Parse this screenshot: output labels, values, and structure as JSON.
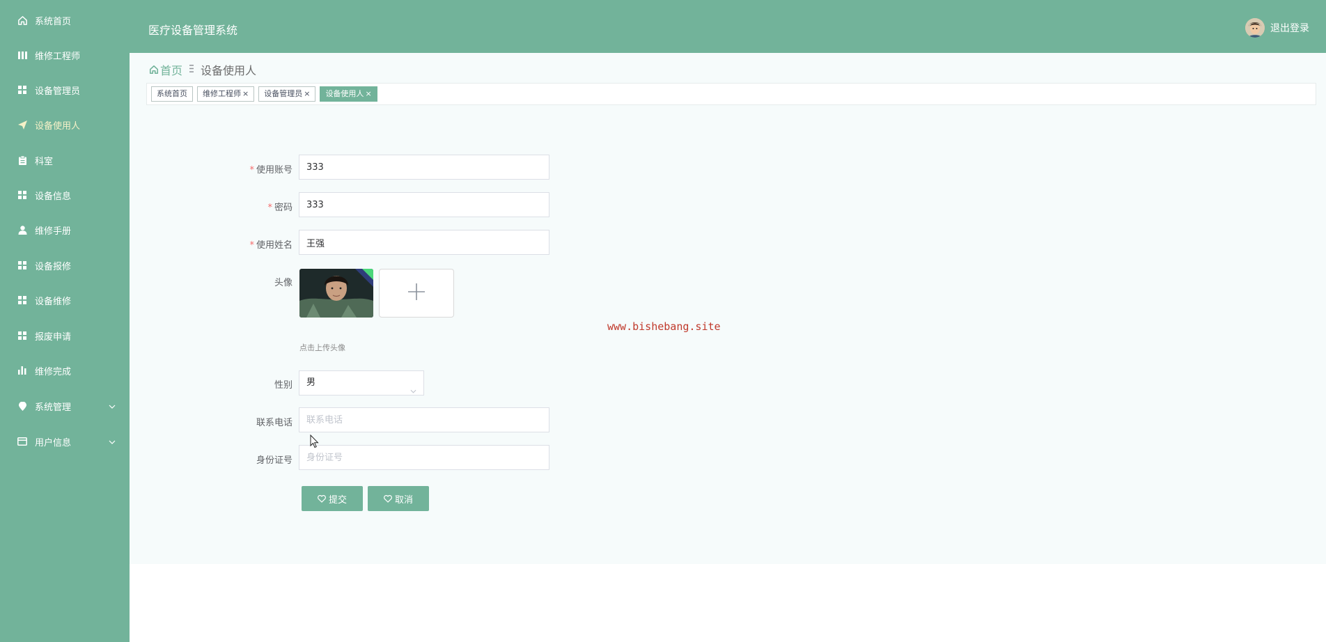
{
  "app": {
    "title": "医疗设备管理系统",
    "logout_label": "退出登录",
    "accent_color": "#72b39a"
  },
  "sidebar": {
    "items": [
      {
        "label": "系统首页",
        "icon": "home-icon"
      },
      {
        "label": "维修工程师",
        "icon": "columns-icon"
      },
      {
        "label": "设备管理员",
        "icon": "grid-icon"
      },
      {
        "label": "设备使用人",
        "icon": "paper-plane-icon",
        "active": true
      },
      {
        "label": "科室",
        "icon": "clipboard-icon"
      },
      {
        "label": "设备信息",
        "icon": "grid-icon"
      },
      {
        "label": "维修手册",
        "icon": "user-icon"
      },
      {
        "label": "设备报修",
        "icon": "grid-icon"
      },
      {
        "label": "设备维修",
        "icon": "grid-icon"
      },
      {
        "label": "报废申请",
        "icon": "grid-icon"
      },
      {
        "label": "维修完成",
        "icon": "bar-chart-icon"
      },
      {
        "label": "系统管理",
        "icon": "location-pin-icon",
        "has_children": true
      },
      {
        "label": "用户信息",
        "icon": "id-card-icon",
        "has_children": true
      }
    ]
  },
  "breadcrumb": {
    "home": "首页",
    "current": "设备使用人"
  },
  "tags": [
    {
      "label": "系统首页",
      "closable": false
    },
    {
      "label": "维修工程师",
      "closable": true
    },
    {
      "label": "设备管理员",
      "closable": true
    },
    {
      "label": "设备使用人",
      "closable": true,
      "active": true
    }
  ],
  "form": {
    "account": {
      "label": "使用账号",
      "value": "333",
      "required": true
    },
    "password": {
      "label": "密码",
      "value": "333",
      "required": true
    },
    "name": {
      "label": "使用姓名",
      "value": "王强",
      "required": true
    },
    "avatar": {
      "label": "头像",
      "hint": "点击上传头像"
    },
    "gender": {
      "label": "性别",
      "value": "男"
    },
    "phone": {
      "label": "联系电话",
      "value": "",
      "placeholder": "联系电话"
    },
    "id_number": {
      "label": "身份证号",
      "value": "",
      "placeholder": "身份证号"
    },
    "submit_label": "提交",
    "cancel_label": "取消"
  },
  "watermark": "www.bishebang.site"
}
